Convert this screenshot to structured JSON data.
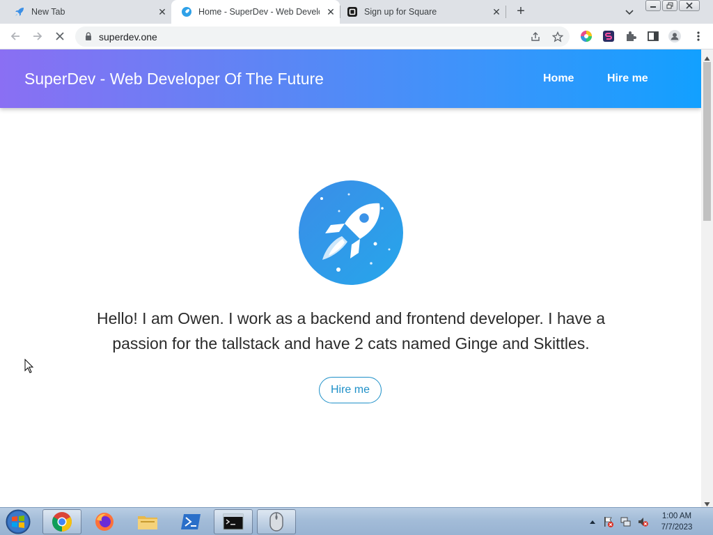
{
  "browser": {
    "tabs": [
      {
        "title": "New Tab",
        "icon": "rocket-icon"
      },
      {
        "title": "Home - SuperDev - Web Developer Of The Future",
        "icon": "superdev-favicon",
        "active": true
      },
      {
        "title": "Sign up for Square",
        "icon": "square-logo-icon"
      }
    ],
    "address": "superdev.one"
  },
  "site": {
    "title": "SuperDev - Web Developer Of The Future",
    "nav": [
      "Home",
      "Hire me"
    ],
    "intro": "Hello! I am Owen. I work as a backend and frontend developer. I have a passion for the tallstack and have 2 cats named Ginge and Skittles.",
    "cta": "Hire me",
    "colors": {
      "header_start": "#8a6ff3",
      "header_end": "#12a0ff",
      "accent": "#1e90c8"
    }
  },
  "taskbar": {
    "apps": [
      "chrome-icon",
      "firefox-icon",
      "file-explorer-icon",
      "powershell-icon",
      "cmd-icon",
      "mouse-icon"
    ],
    "time": "1:00 AM",
    "date": "7/7/2023"
  }
}
